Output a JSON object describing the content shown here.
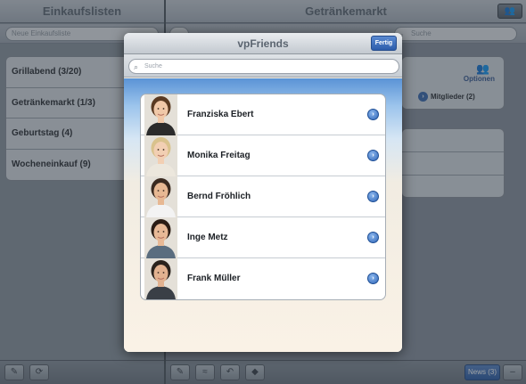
{
  "left_pane": {
    "title": "Einkaufslisten",
    "search_placeholder": "Neue Einkaufsliste",
    "lists": [
      {
        "label": "Grillabend (3/20)"
      },
      {
        "label": "Getränkemarkt (1/3)"
      },
      {
        "label": "Geburtstag (4)"
      },
      {
        "label": "Wocheneinkauf (9)"
      }
    ]
  },
  "right_pane": {
    "title": "Getränkemarkt",
    "search_placeholder": "Suche",
    "options_label": "Optionen",
    "members_label": "Mitglieder (2)",
    "news_label": "News (3)"
  },
  "icons": {
    "group": "group-icon",
    "edit": "pencil-icon",
    "refresh": "refresh-icon",
    "back": "back-arrow-icon",
    "search": "magnifier-icon",
    "disclosure": "disclosure-arrow-icon"
  },
  "modal": {
    "title": "vpFriends",
    "done_label": "Fertig",
    "search_placeholder": "Suche",
    "contacts": [
      {
        "name": "Franziska Ebert",
        "hair": "#5a3a22",
        "skin": "#f0c8a8",
        "shirt": "#2b2b2b"
      },
      {
        "name": "Monika Freitag",
        "hair": "#d9c28d",
        "skin": "#f2cfb3",
        "shirt": "#ece7dd"
      },
      {
        "name": "Bernd Fröhlich",
        "hair": "#3a2a20",
        "skin": "#e7b893",
        "shirt": "#f3f3f3"
      },
      {
        "name": "Inge Metz",
        "hair": "#2b1c14",
        "skin": "#e8b996",
        "shirt": "#5a6d7f"
      },
      {
        "name": "Frank Müller",
        "hair": "#2a221c",
        "skin": "#e2b290",
        "shirt": "#3a3f46"
      }
    ]
  },
  "colors": {
    "accent": "#2f5ea6",
    "disclosure": "#2f65b7"
  }
}
